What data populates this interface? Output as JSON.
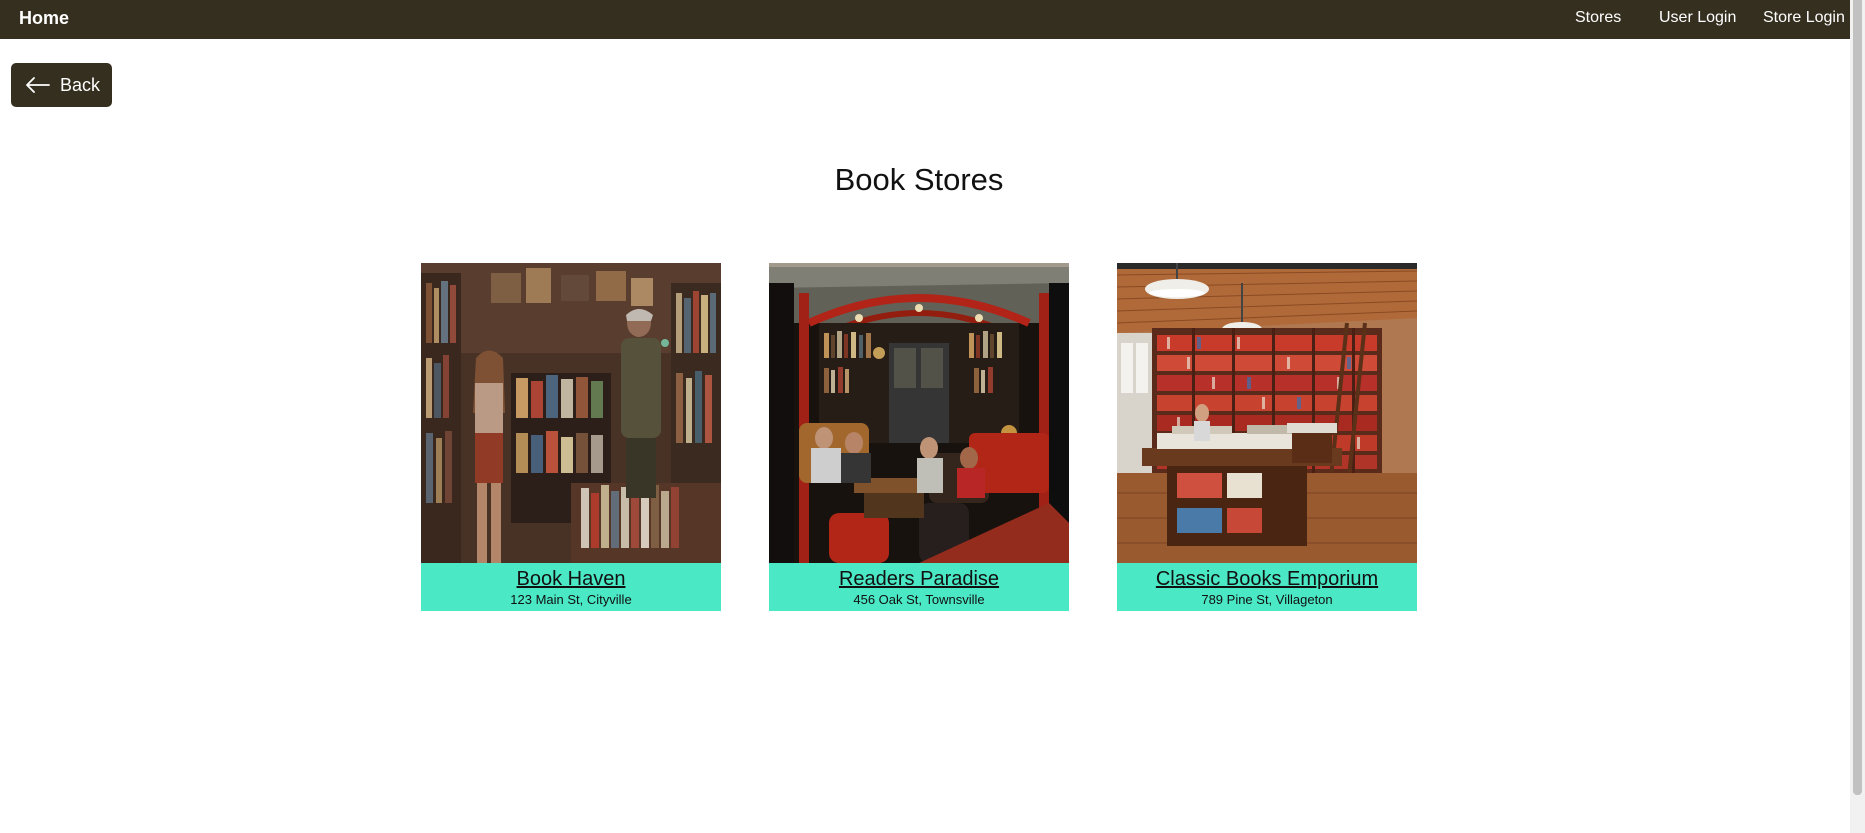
{
  "navbar": {
    "brand": "Home",
    "links": [
      "Stores",
      "User Login",
      "Store Login"
    ]
  },
  "back_button": {
    "label": "Back"
  },
  "page_title": "Book Stores",
  "stores": [
    {
      "name": "Book Haven",
      "address": "123 Main St, Cityville"
    },
    {
      "name": "Readers Paradise",
      "address": "456 Oak St, Townsville"
    },
    {
      "name": "Classic Books Emporium",
      "address": "789 Pine St, Villageton"
    }
  ],
  "colors": {
    "navbar_bg": "#352f1f",
    "card_info_bg": "#4ae8c5",
    "text_light": "#ffffff"
  }
}
